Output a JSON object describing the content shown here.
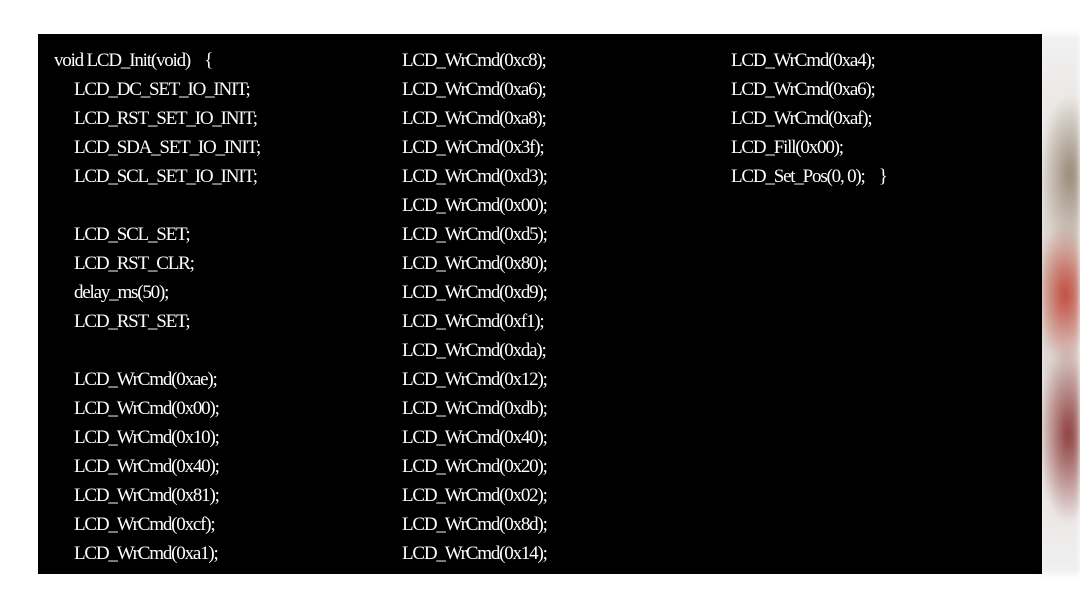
{
  "code": {
    "column1": [
      {
        "text": "void LCD_Init(void)    {",
        "indent": false
      },
      {
        "text": "LCD_DC_SET_IO_INIT;",
        "indent": true
      },
      {
        "text": "LCD_RST_SET_IO_INIT;",
        "indent": true
      },
      {
        "text": "LCD_SDA_SET_IO_INIT;",
        "indent": true
      },
      {
        "text": "LCD_SCL_SET_IO_INIT;",
        "indent": true
      },
      {
        "text": "",
        "indent": true
      },
      {
        "text": "LCD_SCL_SET;",
        "indent": true
      },
      {
        "text": "LCD_RST_CLR;",
        "indent": true
      },
      {
        "text": "delay_ms(50);",
        "indent": true
      },
      {
        "text": "LCD_RST_SET;",
        "indent": true
      },
      {
        "text": "",
        "indent": true
      },
      {
        "text": "LCD_WrCmd(0xae);",
        "indent": true
      },
      {
        "text": "LCD_WrCmd(0x00);",
        "indent": true
      },
      {
        "text": "LCD_WrCmd(0x10);",
        "indent": true
      },
      {
        "text": "LCD_WrCmd(0x40);",
        "indent": true
      },
      {
        "text": "LCD_WrCmd(0x81);",
        "indent": true
      },
      {
        "text": "LCD_WrCmd(0xcf);",
        "indent": true
      },
      {
        "text": "LCD_WrCmd(0xa1);",
        "indent": true
      }
    ],
    "column2": [
      "LCD_WrCmd(0xc8);",
      "LCD_WrCmd(0xa6);",
      "LCD_WrCmd(0xa8);",
      "LCD_WrCmd(0x3f);",
      "LCD_WrCmd(0xd3);",
      "LCD_WrCmd(0x00);",
      "LCD_WrCmd(0xd5);",
      "LCD_WrCmd(0x80);",
      "LCD_WrCmd(0xd9);",
      "LCD_WrCmd(0xf1);",
      "LCD_WrCmd(0xda);",
      "LCD_WrCmd(0x12);",
      "LCD_WrCmd(0xdb);",
      "LCD_WrCmd(0x40);",
      "LCD_WrCmd(0x20);",
      "LCD_WrCmd(0x02);",
      "LCD_WrCmd(0x8d);",
      "LCD_WrCmd(0x14);"
    ],
    "column3": [
      "LCD_WrCmd(0xa4);",
      "LCD_WrCmd(0xa6);",
      "LCD_WrCmd(0xaf);",
      "LCD_Fill(0x00);",
      "LCD_Set_Pos(0, 0);    }"
    ]
  },
  "colors": {
    "panel_background": "#000000",
    "code_text": "#ffffff",
    "page_background": "#ffffff"
  }
}
